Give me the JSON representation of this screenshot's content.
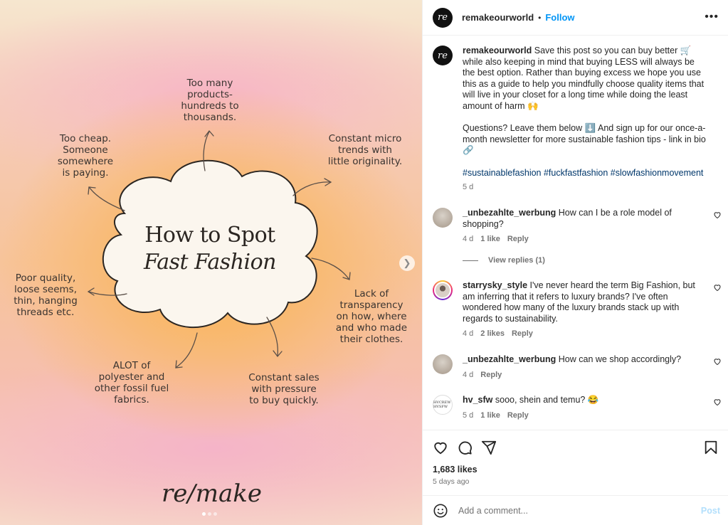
{
  "post": {
    "labels": {
      "too_many": "Too many\nproducts-\nhundreds to\nthousands.",
      "too_cheap": "Too cheap.\nSomeone\nsomewhere\nis paying.",
      "micro_trends": "Constant micro\ntrends with\nlittle originality.",
      "poor_quality": "Poor quality,\nloose seems,\nthin, hanging\nthreads etc.",
      "transparency": "Lack of\ntransparency\non how, where\nand who made\ntheir clothes.",
      "polyester": "ALOT of\npolyester and\nother fossil fuel\nfabrics.",
      "sales": "Constant sales\nwith pressure\nto buy quickly."
    },
    "title_line1": "How to Spot",
    "title_line2": "Fast Fashion",
    "logo": "re/make",
    "slide_count": 3,
    "active_slide": 1
  },
  "header": {
    "username": "remakeourworld",
    "separator": "•",
    "follow_label": "Follow",
    "more_label": "•••",
    "avatar_text": "re"
  },
  "caption": {
    "username": "remakeourworld",
    "text1": "Save this post so you can buy better 🛒 while also keeping in mind that buying LESS will always be the best option. Rather than buying excess we hope you use this as a guide to help you mindfully choose quality items that will live in your closet for a long time while doing the least amount of harm 🙌",
    "text2": "Questions? Leave them below ⬇️ And sign up for our once-a-month newsletter for more sustainable fashion tips - link in bio 🔗",
    "hashtags": "#sustainablefashion #fuckfastfashion #slowfashionmovement",
    "age": "5 d"
  },
  "comments": [
    {
      "username": "_unbezahlte_werbung",
      "text": "How can I be a role model of shopping?",
      "age": "4 d",
      "likes": "1 like",
      "reply": "Reply"
    },
    {
      "username": "starrysky_style",
      "text": "I've never heard the term Big Fashion, but am inferring that it refers to luxury brands? I've often wondered how many of the luxury brands stack up with regards to sustainability.",
      "age": "4 d",
      "likes": "2 likes",
      "reply": "Reply"
    },
    {
      "username": "_unbezahlte_werbung",
      "text": "How can we shop accordingly?",
      "age": "4 d",
      "likes": "",
      "reply": "Reply"
    },
    {
      "username": "hv_sfw",
      "text": "sooo, shein and temu? 😂",
      "age": "5 d",
      "likes": "1 like",
      "reply": "Reply",
      "avatar_text": "HVCREW HVSFW"
    }
  ],
  "view_replies": "View replies (1)",
  "likes_count": "1,683 likes",
  "posted_ago": "5 days ago",
  "add_comment": {
    "placeholder": "Add a comment...",
    "post_label": "Post"
  },
  "icons": {
    "like": "heart-icon",
    "comment": "comment-icon",
    "share": "share-icon",
    "save": "bookmark-icon",
    "emoji": "emoji-icon",
    "next": "chevron-right-icon",
    "more": "more-icon"
  },
  "colors": {
    "link_blue": "#0095f6",
    "hashtag": "#00376b",
    "muted": "#737373",
    "post_disabled": "#b2dffc"
  }
}
